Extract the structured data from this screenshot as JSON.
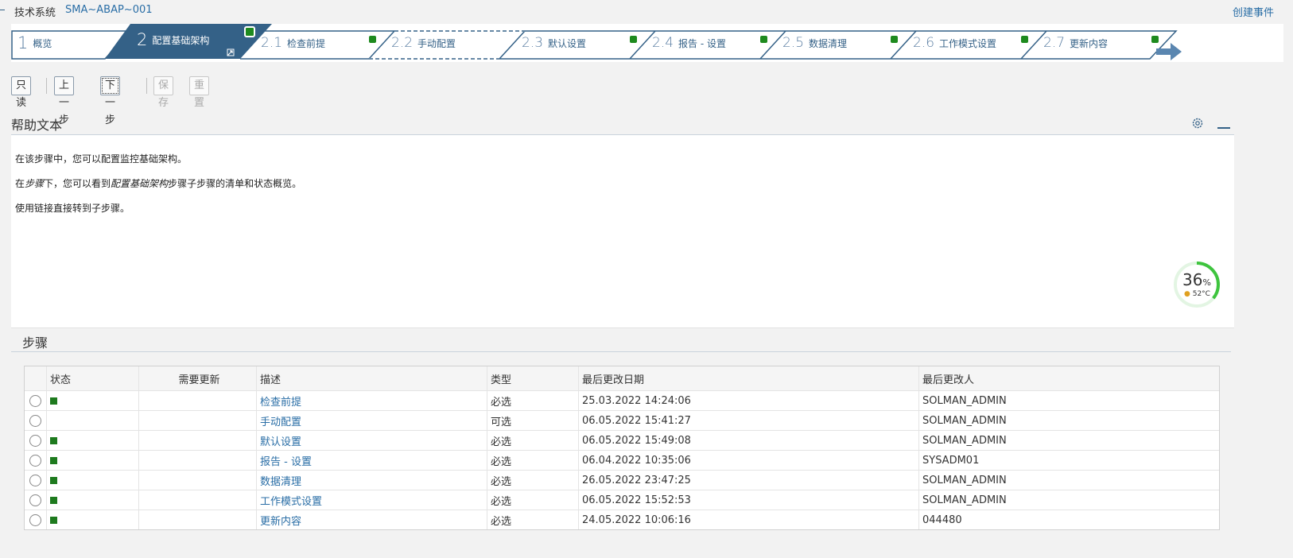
{
  "header": {
    "system_label": "技术系统",
    "system_id": "SMA~ABAP~001",
    "create_event": "创建事件"
  },
  "roadmap": {
    "steps": [
      {
        "num": "1",
        "label": "概览"
      },
      {
        "num": "2",
        "label": "配置基础架构"
      },
      {
        "num": "2.1",
        "label": "检查前提"
      },
      {
        "num": "2.2",
        "label": "手动配置"
      },
      {
        "num": "2.3",
        "label": "默认设置"
      },
      {
        "num": "2.4",
        "label": "报告 - 设置"
      },
      {
        "num": "2.5",
        "label": "数据清理"
      },
      {
        "num": "2.6",
        "label": "工作模式设置"
      },
      {
        "num": "2.7",
        "label": "更新内容"
      }
    ]
  },
  "toolbar": {
    "readonly": "只读",
    "prev": "上一步",
    "next": "下一步",
    "save": "保存",
    "reset": "重置"
  },
  "help": {
    "title": "帮助文本",
    "line1": "在该步骤中，您可以配置监控基础架构。",
    "line2_a": "在",
    "line2_b": "步骤",
    "line2_c": "下，您可以看到",
    "line2_d": "配置基础架构",
    "line2_e": "步骤子步骤的清单和状态概览。",
    "line3": "使用链接直接转到子步骤。"
  },
  "steps": {
    "title": "步骤",
    "columns": [
      "状态",
      "需要更新",
      "描述",
      "类型",
      "最后更改日期",
      "最后更改人"
    ],
    "rows": [
      {
        "status": "green",
        "desc": "检查前提",
        "type": "必选",
        "date": "25.03.2022 14:24:06",
        "user": "SOLMAN_ADMIN"
      },
      {
        "status": "none",
        "desc": "手动配置",
        "type": "可选",
        "date": "06.05.2022 15:41:27",
        "user": "SOLMAN_ADMIN"
      },
      {
        "status": "green",
        "desc": "默认设置",
        "type": "必选",
        "date": "06.05.2022 15:49:08",
        "user": "SOLMAN_ADMIN"
      },
      {
        "status": "green",
        "desc": "报告 - 设置",
        "type": "必选",
        "date": "06.04.2022 10:35:06",
        "user": "SYSADM01"
      },
      {
        "status": "green",
        "desc": "数据清理",
        "type": "必选",
        "date": "26.05.2022 23:47:25",
        "user": "SOLMAN_ADMIN"
      },
      {
        "status": "green",
        "desc": "工作模式设置",
        "type": "必选",
        "date": "06.05.2022 15:52:53",
        "user": "SOLMAN_ADMIN"
      },
      {
        "status": "green",
        "desc": "更新内容",
        "type": "必选",
        "date": "24.05.2022 10:06:16",
        "user": "044480"
      }
    ]
  },
  "gauge": {
    "value": "36",
    "unit": "%",
    "temp": "52°C",
    "fraction": 0.36
  },
  "colors": {
    "accent": "#346187",
    "link": "#2a6ea6",
    "status_green": "#1e7a1e"
  }
}
